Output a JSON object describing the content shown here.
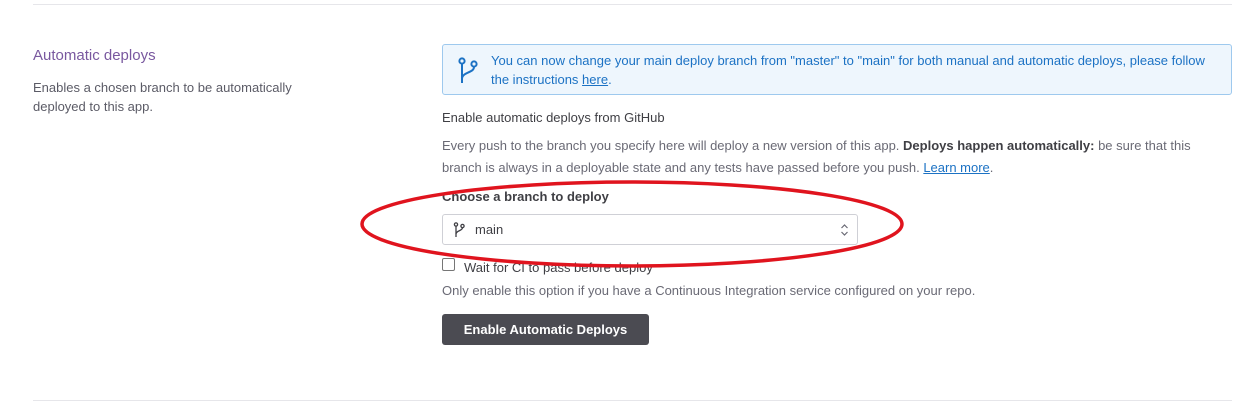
{
  "section": {
    "title": "Automatic deploys",
    "description": "Enables a chosen branch to be automatically deployed to this app."
  },
  "notice": {
    "icon": "git-branch-icon",
    "text": "You can now change your main deploy branch from \"master\" to \"main\" for both manual and automatic deploys, please follow the instructions ",
    "link_text": "here",
    "text_end": "."
  },
  "github": {
    "title": "Enable automatic deploys from GitHub",
    "desc_start": "Every push to the branch you specify here will deploy a new version of this app. ",
    "desc_bold": "Deploys happen automatically:",
    "desc_end": " be sure that this branch is always in a deployable state and any tests have passed before you push. ",
    "learn_more": "Learn more",
    "desc_tail": "."
  },
  "branch": {
    "label": "Choose a branch to deploy",
    "selected": "main",
    "icon": "git-branch-icon"
  },
  "ci": {
    "checkbox_label": "Wait for CI to pass before deploy",
    "checked": false,
    "help": "Only enable this option if you have a Continuous Integration service configured on your repo."
  },
  "button": {
    "label": "Enable Automatic Deploys"
  },
  "colors": {
    "section_title": "#79589f",
    "notice_bg": "#eef6fd",
    "notice_border": "#9ec9ee",
    "link": "#1c72c4",
    "button_bg": "#4b4b52",
    "annotation": "#e0141e"
  }
}
